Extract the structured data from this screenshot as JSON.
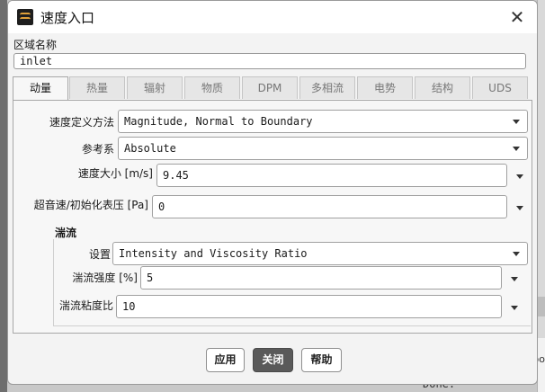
{
  "window": {
    "title": "速度入口"
  },
  "zone": {
    "label": "区域名称",
    "value": "inlet"
  },
  "tabs": [
    {
      "label": "动量",
      "active": true
    },
    {
      "label": "热量"
    },
    {
      "label": "辐射"
    },
    {
      "label": "物质"
    },
    {
      "label": "DPM"
    },
    {
      "label": "多相流"
    },
    {
      "label": "电势"
    },
    {
      "label": "结构"
    },
    {
      "label": "UDS"
    }
  ],
  "momentum": {
    "velocity_method": {
      "label": "速度定义方法",
      "value": "Magnitude, Normal to Boundary"
    },
    "reference_frame": {
      "label": "参考系",
      "value": "Absolute"
    },
    "velocity_magnitude": {
      "label": "速度大小 [m/s]",
      "value": "9.45"
    },
    "gauge_pressure": {
      "label": "超音速/初始化表压 [Pa]",
      "value": "0"
    }
  },
  "turbulence": {
    "title": "湍流",
    "spec": {
      "label": "设置",
      "value": "Intensity and Viscosity Ratio"
    },
    "intensity": {
      "label": "湍流强度 [%]",
      "value": "5"
    },
    "viscosity_ratio": {
      "label": "湍流粘度比",
      "value": "10"
    }
  },
  "buttons": {
    "apply": "应用",
    "close": "关闭",
    "help": "帮助"
  },
  "background": {
    "right_text": "oo",
    "bottom_text": "Done."
  }
}
